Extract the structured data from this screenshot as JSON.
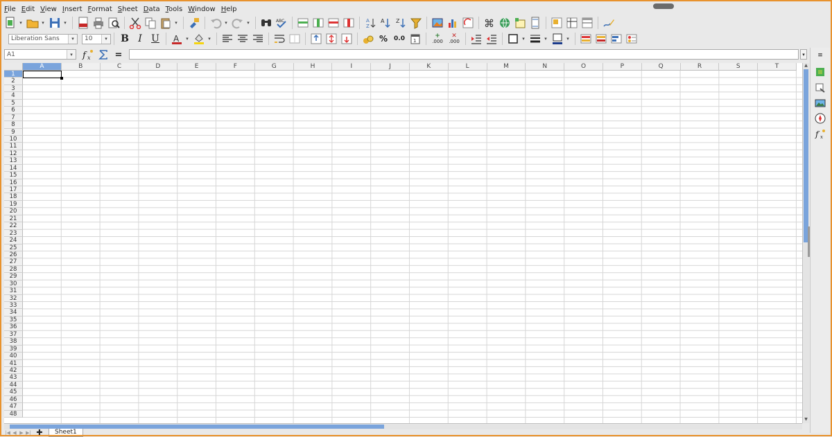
{
  "menu": [
    "File",
    "Edit",
    "View",
    "Insert",
    "Format",
    "Sheet",
    "Data",
    "Tools",
    "Window",
    "Help"
  ],
  "toolbar": {
    "font_name": "Liberation Sans",
    "font_size": "10",
    "bold": "B",
    "italic": "I",
    "underline": "U",
    "percent": "%",
    "decimal": "0.0",
    "add_decimal": ".000",
    "remove_decimal": ".000"
  },
  "formula": {
    "name_box": "A1",
    "equals": "=",
    "value": ""
  },
  "grid": {
    "columns": [
      "A",
      "B",
      "C",
      "D",
      "E",
      "F",
      "G",
      "H",
      "I",
      "J",
      "K",
      "L",
      "M",
      "N",
      "O",
      "P",
      "Q",
      "R",
      "S",
      "T"
    ],
    "rows": [
      "1",
      "2",
      "3",
      "4",
      "5",
      "6",
      "7",
      "8",
      "9",
      "10",
      "11",
      "12",
      "13",
      "14",
      "15",
      "16",
      "17",
      "18",
      "19",
      "20",
      "21",
      "22",
      "23",
      "24",
      "25",
      "26",
      "27",
      "28",
      "29",
      "30",
      "31",
      "32",
      "33",
      "34",
      "35",
      "36",
      "37",
      "38",
      "39",
      "40",
      "41",
      "42",
      "43",
      "44",
      "45",
      "46",
      "47",
      "48"
    ],
    "active_cell": "A1"
  },
  "sheets": [
    "Sheet1"
  ],
  "colors": {
    "accent": "#7aa4dc",
    "frame": "#e8922d"
  }
}
